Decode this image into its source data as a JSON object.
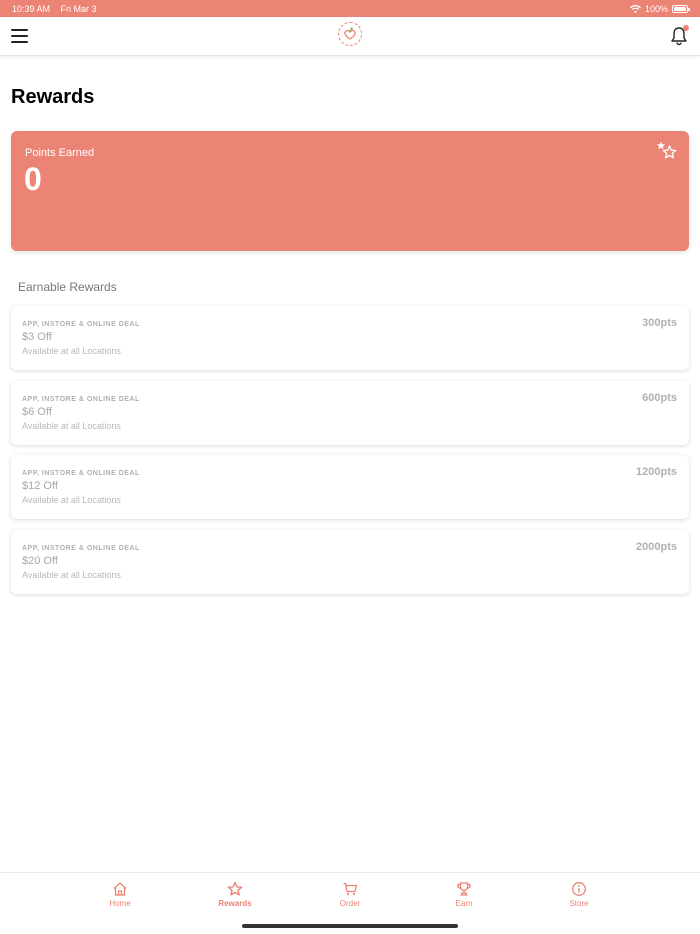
{
  "status": {
    "time": "10:39 AM",
    "date": "Fri Mar 3",
    "battery": "100%"
  },
  "colors": {
    "accent": "#ec8476"
  },
  "page": {
    "title": "Rewards"
  },
  "points": {
    "label": "Points Earned",
    "value": "0"
  },
  "earnable": {
    "title": "Earnable Rewards",
    "items": [
      {
        "tag": "APP, INSTORE & ONLINE DEAL",
        "name": "$3 Off",
        "note": "Available at all Locations",
        "points": "300pts"
      },
      {
        "tag": "APP, INSTORE & ONLINE DEAL",
        "name": "$6 Off",
        "note": "Available at all Locations",
        "points": "600pts"
      },
      {
        "tag": "APP, INSTORE & ONLINE DEAL",
        "name": "$12 Off",
        "note": "Available at all Locations",
        "points": "1200pts"
      },
      {
        "tag": "APP, INSTORE & ONLINE DEAL",
        "name": "$20 Off",
        "note": "Available at all Locations",
        "points": "2000pts"
      }
    ]
  },
  "tabs": [
    {
      "label": "Home",
      "icon": "home-icon"
    },
    {
      "label": "Rewards",
      "icon": "star-icon"
    },
    {
      "label": "Order",
      "icon": "cart-icon"
    },
    {
      "label": "Earn",
      "icon": "trophy-icon"
    },
    {
      "label": "Store",
      "icon": "info-icon"
    }
  ]
}
